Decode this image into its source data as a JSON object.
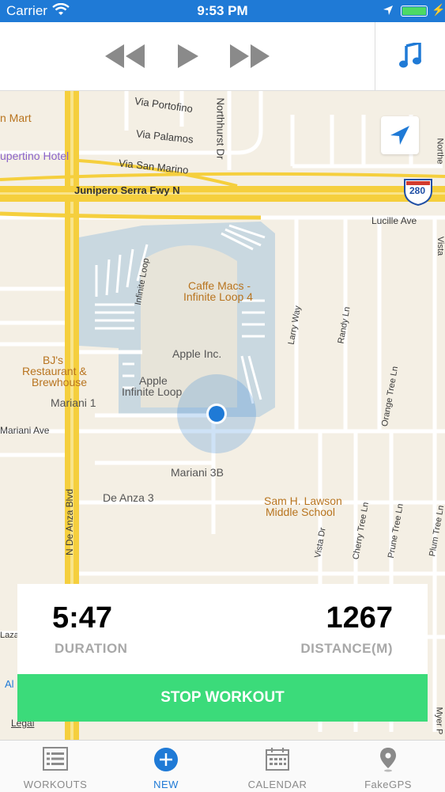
{
  "status_bar": {
    "carrier": "Carrier",
    "time": "9:53 PM"
  },
  "player": {
    "rewind_icon": "rewind-icon",
    "play_icon": "play-icon",
    "forward_icon": "fast-forward-icon",
    "music_icon": "music-note-icon"
  },
  "map": {
    "labels": {
      "mart": "n Mart",
      "hotel": "upertino Hotel",
      "via_portofino": "Via Portofino",
      "via_palamos": "Via Palamos",
      "via_san_marino": "Via San Marino",
      "northhurst": "Northhurst Dr",
      "junipero": "Junipero Serra Fwy N",
      "highway": "280",
      "lucille": "Lucille Ave",
      "caffe_macs": "Caffe Macs -",
      "infinite_loop_4": "Infinite Loop 4",
      "infinite_loop_road": "Infinite Loop",
      "apple_inc": "Apple Inc.",
      "apple_il_1": "Apple",
      "apple_il_2": "Infinite Loop",
      "bjs_1": "BJ's",
      "bjs_2": "Restaurant &",
      "bjs_3": "Brewhouse",
      "mariani_1": "Mariani 1",
      "mariani_ave": "Mariani Ave",
      "mariani_3b": "Mariani 3B",
      "de_anza_3": "De Anza 3",
      "n_de_anza": "N De Anza Blvd",
      "larry_way": "Larry Way",
      "randy_ln": "Randy Ln",
      "orange_tree": "Orange Tree Ln",
      "lawson_1": "Sam H. Lawson",
      "lawson_2": "Middle School",
      "cherry_tree": "Cherry Tree Ln",
      "prune_tree": "Prune Tree Ln",
      "plum_tree": "Plum Tree Ln",
      "vista_dr": "Vista Dr",
      "northe": "Northe",
      "vista_edge": "Vista",
      "laza": "Laza",
      "al": "Al",
      "legal": "Legal",
      "myer": "Myer P"
    }
  },
  "workout": {
    "duration_value": "5:47",
    "duration_label": "DURATION",
    "distance_value": "1267",
    "distance_label": "DISTANCE(M)",
    "stop_label": "STOP WORKOUT"
  },
  "tabs": [
    {
      "label": "WORKOUTS",
      "icon": "list-icon",
      "active": false
    },
    {
      "label": "NEW",
      "icon": "plus-circle-icon",
      "active": true
    },
    {
      "label": "CALENDAR",
      "icon": "calendar-icon",
      "active": false
    },
    {
      "label": "FakeGPS",
      "icon": "map-pin-icon",
      "active": false
    }
  ],
  "colors": {
    "accent": "#1f7ad6",
    "stop_button": "#3bdb7a",
    "freeway": "#f5cf3d",
    "campus": "#c9d8e0"
  }
}
